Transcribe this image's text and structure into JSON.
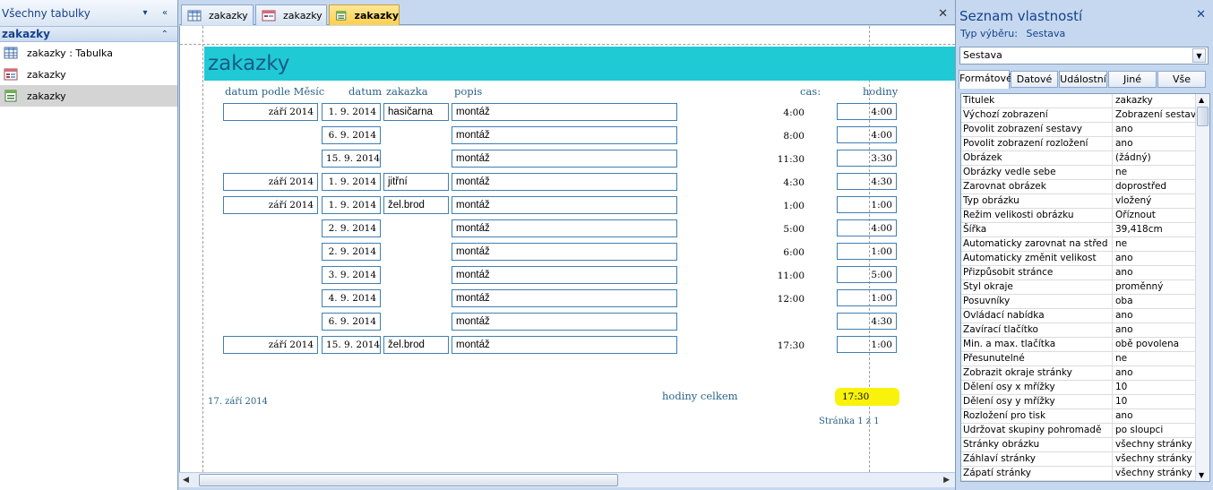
{
  "nav": {
    "title": "Všechny tabulky",
    "group": "zakazky",
    "items": [
      {
        "label": "zakazky : Tabulka",
        "icon": "table-icon"
      },
      {
        "label": "zakazky",
        "icon": "form-icon"
      },
      {
        "label": "zakazky",
        "icon": "report-icon"
      }
    ]
  },
  "tabs": [
    {
      "label": "zakazky",
      "icon": "table-icon"
    },
    {
      "label": "zakazky",
      "icon": "form-icon"
    },
    {
      "label": "zakazky",
      "icon": "report-icon"
    }
  ],
  "report": {
    "title": "zakazky",
    "headers": {
      "mesic": "datum podle Měsíc",
      "datum": "datum",
      "zakazka": "zakazka",
      "popis": "popis",
      "cas": "cas:",
      "hodiny": "hodiny"
    },
    "rows": [
      {
        "mesic": "září 2014",
        "datum": "1. 9. 2014",
        "zakazka": "hasičarna",
        "popis": "montáž",
        "cas": "4:00",
        "hodiny": "4:00"
      },
      {
        "mesic": "",
        "datum": "6. 9. 2014",
        "zakazka": "",
        "popis": "montáž",
        "cas": "8:00",
        "hodiny": "4:00"
      },
      {
        "mesic": "",
        "datum": "15. 9. 2014",
        "zakazka": "",
        "popis": "montáž",
        "cas": "11:30",
        "hodiny": "3:30"
      },
      {
        "mesic": "září 2014",
        "datum": "1. 9. 2014",
        "zakazka": "jitřní",
        "popis": "montáž",
        "cas": "4:30",
        "hodiny": "4:30"
      },
      {
        "mesic": "září 2014",
        "datum": "1. 9. 2014",
        "zakazka": "žel.brod",
        "popis": "montáž",
        "cas": "1:00",
        "hodiny": "1:00"
      },
      {
        "mesic": "",
        "datum": "2. 9. 2014",
        "zakazka": "",
        "popis": "montáž",
        "cas": "5:00",
        "hodiny": "4:00"
      },
      {
        "mesic": "",
        "datum": "2. 9. 2014",
        "zakazka": "",
        "popis": "montáž",
        "cas": "6:00",
        "hodiny": "1:00"
      },
      {
        "mesic": "",
        "datum": "3. 9. 2014",
        "zakazka": "",
        "popis": "montáž",
        "cas": "11:00",
        "hodiny": "5:00"
      },
      {
        "mesic": "",
        "datum": "4. 9. 2014",
        "zakazka": "",
        "popis": "montáž",
        "cas": "12:00",
        "hodiny": "1:00"
      },
      {
        "mesic": "",
        "datum": "6. 9. 2014",
        "zakazka": "",
        "popis": "montáž",
        "cas": "",
        "hodiny": "4:30"
      },
      {
        "mesic": "září 2014",
        "datum": "15. 9. 2014",
        "zakazka": "žel.brod",
        "popis": "montáž",
        "cas": "17:30",
        "hodiny": "1:00"
      }
    ],
    "footer": {
      "date": "17. září 2014",
      "total_label": "hodiny celkem",
      "total_value": "17:30",
      "page": "Stránka 1 z 1"
    }
  },
  "props": {
    "title": "Seznam vlastností",
    "selection_label": "Typ výběru:",
    "selection_value": "Sestava",
    "object": "Sestava",
    "tabs": [
      "Formátové",
      "Datové",
      "Událostní",
      "Jiné",
      "Vše"
    ],
    "active_tab": "Formátové",
    "rows": [
      {
        "name": "Titulek",
        "value": "zakazky"
      },
      {
        "name": "Výchozí zobrazení",
        "value": "Zobrazení sestavy"
      },
      {
        "name": "Povolit zobrazení sestavy",
        "value": "ano"
      },
      {
        "name": "Povolit zobrazení rozložení",
        "value": "ano"
      },
      {
        "name": "Obrázek",
        "value": "(žádný)"
      },
      {
        "name": "Obrázky vedle sebe",
        "value": "ne"
      },
      {
        "name": "Zarovnat obrázek",
        "value": "doprostřed"
      },
      {
        "name": "Typ obrázku",
        "value": "vložený"
      },
      {
        "name": "Režim velikosti obrázku",
        "value": "Oříznout"
      },
      {
        "name": "Šířka",
        "value": "39,418cm"
      },
      {
        "name": "Automaticky zarovnat na střed",
        "value": "ne"
      },
      {
        "name": "Automaticky změnit velikost",
        "value": "ano"
      },
      {
        "name": "Přizpůsobit stránce",
        "value": "ano"
      },
      {
        "name": "Styl okraje",
        "value": "proměnný"
      },
      {
        "name": "Posuvníky",
        "value": "oba"
      },
      {
        "name": "Ovládací nabídka",
        "value": "ano"
      },
      {
        "name": "Zavírací tlačítko",
        "value": "ano"
      },
      {
        "name": "Min. a max. tlačítka",
        "value": "obě povolena"
      },
      {
        "name": "Přesunutelné",
        "value": "ne"
      },
      {
        "name": "Zobrazit okraje stránky",
        "value": "ano"
      },
      {
        "name": "Dělení osy x mřížky",
        "value": "10"
      },
      {
        "name": "Dělení osy y mřížky",
        "value": "10"
      },
      {
        "name": "Rozložení pro tisk",
        "value": "ano"
      },
      {
        "name": "Udržovat skupiny pohromadě",
        "value": "po sloupci"
      },
      {
        "name": "Stránky obrázku",
        "value": "všechny stránky"
      },
      {
        "name": "Záhlaví stránky",
        "value": "všechny stránky"
      },
      {
        "name": "Zápatí stránky",
        "value": "všechny stránky"
      }
    ]
  },
  "colors": {
    "title_band": "#1fcad5",
    "highlight": "#f8f20c",
    "active_tab": "#ffd04d"
  }
}
